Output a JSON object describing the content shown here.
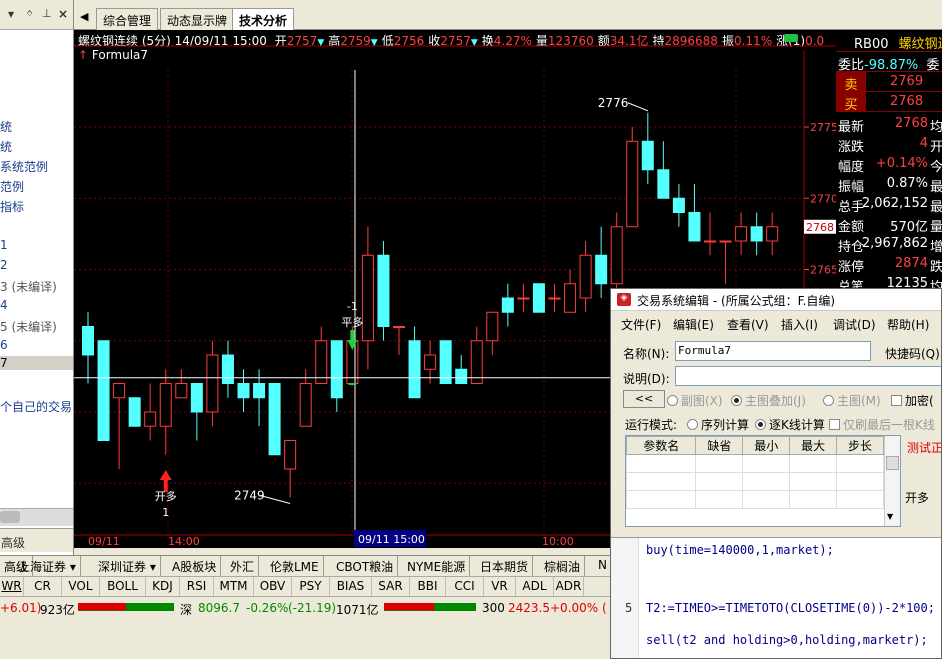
{
  "left_panel": {
    "title_icons": [
      "dropdown-icon",
      "pin-icon",
      "close-icon"
    ],
    "items": [
      "统",
      "统",
      "系统范例",
      "范例",
      "指标",
      "1",
      "2",
      "3 (未编译)",
      "4",
      "5 (未编译)",
      "6",
      "7",
      "个自己的交易"
    ],
    "bottom_label": "高级"
  },
  "tabs": {
    "items": [
      "综合管理",
      "动态显示牌",
      "技术分析"
    ],
    "active": "技术分析"
  },
  "chart": {
    "header": "螺纹钢连续 (5分) 14/09/11 15:00",
    "stats": [
      {
        "label": "开",
        "value": "2757",
        "arrow": "▼"
      },
      {
        "label": "高",
        "value": "2759",
        "arrow": "▼"
      },
      {
        "label": "低",
        "value": "2756",
        "arrow": ""
      },
      {
        "label": "收",
        "value": "2757",
        "arrow": "▼"
      },
      {
        "label": "换",
        "value": "4.27%",
        "arrow": ""
      },
      {
        "label": "量",
        "value": "123760",
        "arrow": ""
      },
      {
        "label": "额",
        "value": "34.1亿",
        "arrow": ""
      },
      {
        "label": "持",
        "value": "2896688",
        "arrow": ""
      },
      {
        "label": "振",
        "value": "0.11%",
        "arrow": ""
      },
      {
        "label": "涨(1)",
        "value": "0.0",
        "arrow": ""
      }
    ],
    "formula_label": "Formula7",
    "high_label": "2776",
    "low_label": "2749",
    "price_ticks": [
      "2775",
      "2770",
      "2765"
    ],
    "current_price": "2768",
    "x_labels": [
      "09/11",
      "14:00",
      "10:00"
    ],
    "cursor_time": "09/11 15:00",
    "signals": [
      {
        "text": "开多",
        "sub": "1"
      },
      {
        "text": "平多",
        "sub": "-1"
      }
    ]
  },
  "chart_data": {
    "type": "candlestick",
    "title": "螺纹钢连续 (5分)",
    "xlabel": "",
    "ylabel": "",
    "ylim": [
      2747,
      2779
    ],
    "colors": {
      "up": "#ff3c3c",
      "down": "#54ffff"
    },
    "candles": [
      {
        "o": 2761,
        "h": 2762,
        "l": 2757,
        "c": 2759
      },
      {
        "o": 2760,
        "h": 2760,
        "l": 2753,
        "c": 2753
      },
      {
        "o": 2756,
        "h": 2757,
        "l": 2751,
        "c": 2757
      },
      {
        "o": 2756,
        "h": 2756,
        "l": 2754,
        "c": 2754
      },
      {
        "o": 2754,
        "h": 2757,
        "l": 2753,
        "c": 2755
      },
      {
        "o": 2754,
        "h": 2758,
        "l": 2752,
        "c": 2757
      },
      {
        "o": 2756,
        "h": 2758,
        "l": 2756,
        "c": 2757
      },
      {
        "o": 2757,
        "h": 2757,
        "l": 2753,
        "c": 2755
      },
      {
        "o": 2755,
        "h": 2760,
        "l": 2754,
        "c": 2759
      },
      {
        "o": 2759,
        "h": 2760,
        "l": 2756,
        "c": 2757
      },
      {
        "o": 2757,
        "h": 2758,
        "l": 2755,
        "c": 2756
      },
      {
        "o": 2757,
        "h": 2758,
        "l": 2754,
        "c": 2756
      },
      {
        "o": 2757,
        "h": 2757,
        "l": 2752,
        "c": 2752
      },
      {
        "o": 2751,
        "h": 2753,
        "l": 2749,
        "c": 2753
      },
      {
        "o": 2754,
        "h": 2758,
        "l": 2754,
        "c": 2757
      },
      {
        "o": 2757,
        "h": 2761,
        "l": 2757,
        "c": 2760
      },
      {
        "o": 2760,
        "h": 2760,
        "l": 2755,
        "c": 2756
      },
      {
        "o": 2757,
        "h": 2761,
        "l": 2757,
        "c": 2760
      },
      {
        "o": 2760,
        "h": 2768,
        "l": 2758,
        "c": 2766
      },
      {
        "o": 2766,
        "h": 2767,
        "l": 2760,
        "c": 2761
      },
      {
        "o": 2761,
        "h": 2761,
        "l": 2759,
        "c": 2761
      },
      {
        "o": 2760,
        "h": 2761,
        "l": 2756,
        "c": 2756
      },
      {
        "o": 2758,
        "h": 2760,
        "l": 2757,
        "c": 2759
      },
      {
        "o": 2760,
        "h": 2760,
        "l": 2757,
        "c": 2757
      },
      {
        "o": 2758,
        "h": 2759,
        "l": 2757,
        "c": 2757
      },
      {
        "o": 2757,
        "h": 2761,
        "l": 2757,
        "c": 2760
      },
      {
        "o": 2760,
        "h": 2762,
        "l": 2759,
        "c": 2762
      },
      {
        "o": 2763,
        "h": 2764,
        "l": 2761,
        "c": 2762
      },
      {
        "o": 2763,
        "h": 2764,
        "l": 2762,
        "c": 2763
      },
      {
        "o": 2764,
        "h": 2764,
        "l": 2762,
        "c": 2762
      },
      {
        "o": 2763,
        "h": 2764,
        "l": 2762,
        "c": 2763
      },
      {
        "o": 2762,
        "h": 2765,
        "l": 2762,
        "c": 2764
      },
      {
        "o": 2763,
        "h": 2767,
        "l": 2762,
        "c": 2766
      },
      {
        "o": 2766,
        "h": 2768,
        "l": 2763,
        "c": 2764
      },
      {
        "o": 2764,
        "h": 2769,
        "l": 2763,
        "c": 2768
      },
      {
        "o": 2768,
        "h": 2775,
        "l": 2768,
        "c": 2774
      },
      {
        "o": 2774,
        "h": 2776,
        "l": 2771,
        "c": 2772
      },
      {
        "o": 2772,
        "h": 2774,
        "l": 2770,
        "c": 2770
      },
      {
        "o": 2770,
        "h": 2771,
        "l": 2768,
        "c": 2769
      },
      {
        "o": 2769,
        "h": 2771,
        "l": 2767,
        "c": 2767
      },
      {
        "o": 2767,
        "h": 2769,
        "l": 2766,
        "c": 2767
      },
      {
        "o": 2767,
        "h": 2767,
        "l": 2764,
        "c": 2767
      },
      {
        "o": 2767,
        "h": 2769,
        "l": 2766,
        "c": 2768
      },
      {
        "o": 2768,
        "h": 2769,
        "l": 2766,
        "c": 2767
      },
      {
        "o": 2767,
        "h": 2769,
        "l": 2766,
        "c": 2768
      }
    ]
  },
  "right_panel": {
    "code": "RB00",
    "name": "螺纹钢连",
    "wb_label": "委比",
    "wb_value": "-98.87%",
    "wb_extra": "委",
    "sell_label": "卖",
    "sell_price": "2769",
    "buy_label": "买",
    "buy_price": "2768",
    "rows": [
      {
        "l": "最新",
        "v": "2768",
        "r": "均",
        "color": "#ff4040"
      },
      {
        "l": "涨跌",
        "v": "4",
        "r": "开",
        "color": "#ff4040"
      },
      {
        "l": "幅度",
        "v": "+0.14%",
        "r": "今",
        "color": "#ff4040"
      },
      {
        "l": "振幅",
        "v": "0.87%",
        "r": "最",
        "color": "#ffffff"
      },
      {
        "l": "总手",
        "v": "2,062,152",
        "r": "最",
        "color": "#ffffff"
      },
      {
        "l": "金额",
        "v": "570亿",
        "r": "量",
        "color": "#ffffff"
      },
      {
        "l": "持仓",
        "v": "2,967,862",
        "r": "增",
        "color": "#ffffff"
      },
      {
        "l": "涨停",
        "v": "2874",
        "r": "跌",
        "color": "#ff4040"
      },
      {
        "l": "总笔",
        "v": "12135",
        "r": "均",
        "color": "#ffffff"
      }
    ]
  },
  "bottom_tabs": [
    "高级",
    "上海证券 ▾",
    "深圳证券 ▾",
    "A股板块",
    "外汇",
    "伦敦LME",
    "CBOT粮油",
    "NYME能源",
    "日本期货",
    "棕榈油",
    "N"
  ],
  "indicators": [
    "WR",
    "CR",
    "VOL",
    "BOLL",
    "KDJ",
    "RSI",
    "MTM",
    "OBV",
    "PSY",
    "BIAS",
    "SAR",
    "BBI",
    "CCI",
    "VR",
    "ADL",
    "ADR"
  ],
  "status": {
    "left_change": "+6.01)",
    "left_amount": "923亿",
    "sz_label": "深",
    "sz_value": "8096.7",
    "sz_change": "-0.26%",
    "sz_diff": "(-21.19)",
    "sz_amount": "1071亿",
    "right_value": "300",
    "right_price": "2423.5",
    "right_change": "+0.00%",
    "right_tail": "("
  },
  "dialog": {
    "title": "交易系统编辑 - (所属公式组：F.自编)",
    "menu": [
      "文件(F)",
      "编辑(E)",
      "查看(V)",
      "插入(I)",
      "调试(D)",
      "帮助(H)"
    ],
    "name_label": "名称(N):",
    "name_value": "Formula7",
    "hotkey_label": "快捷码(Q):",
    "desc_label": "说明(D):",
    "desc_value": "",
    "back_button": "<<",
    "chart_options": [
      {
        "label": "副图(X)",
        "on": false
      },
      {
        "label": "主图叠加(J)",
        "on": true
      },
      {
        "label": "主图(M)",
        "on": false
      }
    ],
    "encrypt_label": "加密(",
    "run_mode_label": "运行模式:",
    "run_modes": [
      {
        "label": "序列计算",
        "on": false
      },
      {
        "label": "逐K线计算",
        "on": true
      }
    ],
    "refresh_label": "仅刷最后一根K线",
    "param_headers": [
      "参数名",
      "缺省",
      "最小",
      "最大",
      "步长"
    ],
    "test_label": "测试正",
    "open_long_button": "开多",
    "code_lines": [
      {
        "num": "",
        "text": "buy(time=140000,1,market);"
      },
      {
        "num": "5",
        "text": "T2:=TIMEO>=TIMETOTO(CLOSETIME(0))-2*100;"
      },
      {
        "num": "",
        "text": "sell(t2 and holding>0,holding,marketr);"
      }
    ]
  }
}
